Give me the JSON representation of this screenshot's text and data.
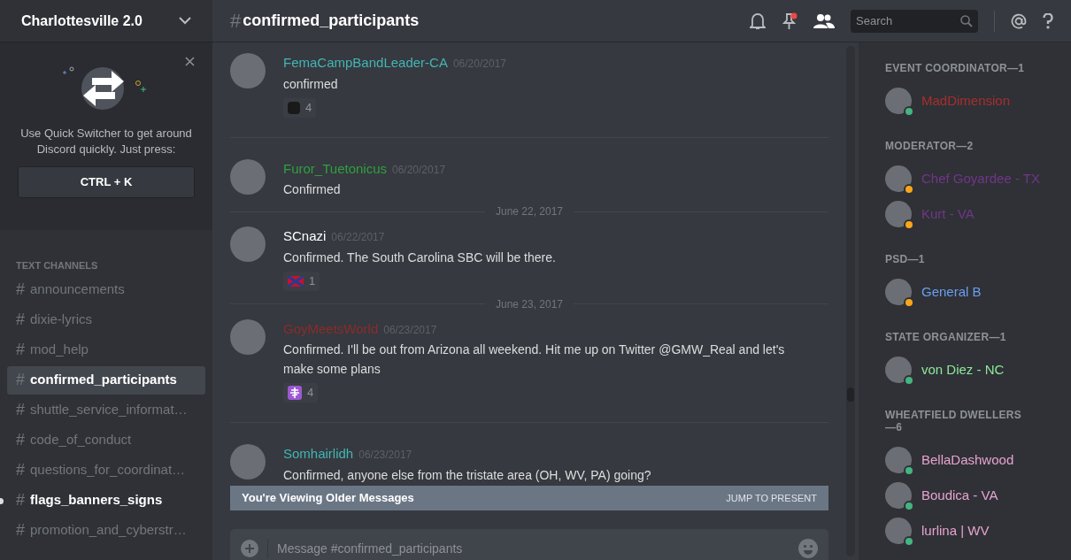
{
  "server": {
    "name": "Charlottesville 2.0"
  },
  "quick_switcher": {
    "text": "Use Quick Switcher to get around Discord quickly. Just press:",
    "shortcut": "CTRL + K"
  },
  "channel_category": "TEXT CHANNELS",
  "channels": [
    {
      "hash": "#",
      "name": "announcements",
      "selected": false,
      "unread": false
    },
    {
      "hash": "#",
      "name": "dixie-lyrics",
      "selected": false,
      "unread": false
    },
    {
      "hash": "#",
      "name": "mod_help",
      "selected": false,
      "unread": false
    },
    {
      "hash": "#",
      "name": "confirmed_participants",
      "selected": true,
      "unread": false
    },
    {
      "hash": "#",
      "name": "shuttle_service_informat…",
      "selected": false,
      "unread": false
    },
    {
      "hash": "#",
      "name": "code_of_conduct",
      "selected": false,
      "unread": false
    },
    {
      "hash": "#",
      "name": "questions_for_coordinat…",
      "selected": false,
      "unread": false
    },
    {
      "hash": "#",
      "name": "flags_banners_signs",
      "selected": false,
      "unread": true
    },
    {
      "hash": "#",
      "name": "promotion_and_cyberstr…",
      "selected": false,
      "unread": false
    }
  ],
  "header": {
    "hash": "#",
    "channel": "confirmed_participants",
    "search_placeholder": "Search",
    "pins_unread": true
  },
  "messages": [
    {
      "kind": "message",
      "author": "FemaCampBandLeader-CA",
      "color": "#43b5b5",
      "time": "06/20/2017",
      "text": [
        "confirmed"
      ],
      "reaction": {
        "kind": "text",
        "count": "4"
      }
    },
    {
      "kind": "message",
      "author": "Furor_Tuetonicus",
      "color": "#2ea043",
      "time": "06/20/2017",
      "text": [
        "Confirmed"
      ]
    },
    {
      "kind": "divider",
      "text": "June 22, 2017"
    },
    {
      "kind": "message",
      "author": "SCnazi",
      "color": "#ffffff",
      "time": "06/22/2017",
      "text": [
        "Confirmed. The South Carolina SBC will be there."
      ],
      "reaction": {
        "kind": "flag",
        "count": "1"
      }
    },
    {
      "kind": "divider",
      "text": "June 23, 2017"
    },
    {
      "kind": "message",
      "author": "GoyMeetsWorld",
      "color": "#8a2c2c",
      "time": "06/23/2017",
      "text": [
        "Confirmed. I'll be out from Arizona all weekend. Hit me up on Twitter @GMW_Real and let's",
        "make some plans"
      ],
      "reaction": {
        "kind": "cross",
        "count": "4"
      }
    },
    {
      "kind": "message",
      "author": "Somhairlidh",
      "color": "#43b5b5",
      "time": "06/23/2017",
      "text": [
        "Confirmed, anyone else from the tristate area (OH, WV, PA) going?"
      ]
    }
  ],
  "older_banner": {
    "text": "You're Viewing Older Messages",
    "action": "JUMP TO PRESENT"
  },
  "composer": {
    "placeholder": "Message #confirmed_participants"
  },
  "member_groups": [
    {
      "title": "EVENT COORDINATOR—1",
      "members": [
        {
          "name": "MadDimension",
          "color": "#a82e2e",
          "idle": false
        }
      ]
    },
    {
      "title": "MODERATOR—2",
      "members": [
        {
          "name": "Chef Goyardee - TX",
          "color": "#71368a",
          "idle": true
        },
        {
          "name": "Kurt - VA",
          "color": "#71368a",
          "idle": true
        }
      ]
    },
    {
      "title": "PSD—1",
      "members": [
        {
          "name": "General B",
          "color": "#6c9ef0",
          "idle": true
        }
      ]
    },
    {
      "title": "STATE ORGANIZER—1",
      "members": [
        {
          "name": "von Diez - NC",
          "color": "#8ee89a",
          "idle": false
        }
      ]
    },
    {
      "title": "WHEATFIELD DWELLERS—6",
      "members": [
        {
          "name": "BellaDashwood",
          "color": "#e8a3d0",
          "idle": false
        },
        {
          "name": "Boudica - VA",
          "color": "#e8a3d0",
          "idle": false
        },
        {
          "name": "lurlina | WV",
          "color": "#e8a3d0",
          "idle": false
        }
      ]
    }
  ]
}
